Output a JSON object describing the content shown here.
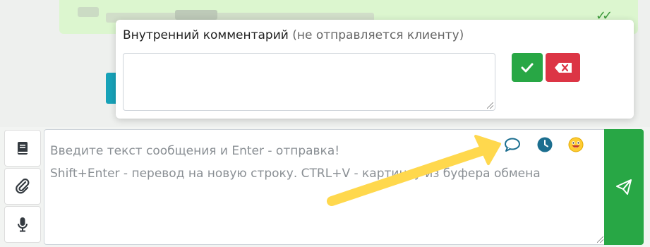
{
  "popup": {
    "title": "Внутренний комментарий",
    "subtitle": "(не отправляется клиенту)",
    "comment_value": "",
    "confirm_icon": "check-icon",
    "cancel_icon": "backspace-icon"
  },
  "composer": {
    "placeholder": "Введите текст сообщения и Enter - отправка!\nShift+Enter - перевод на новую строку. CTRL+V - картинку из буфера обмена",
    "icons": [
      "comment-icon",
      "clock-icon",
      "emoji-icon"
    ]
  },
  "sidebar": {
    "icons": [
      "book-icon",
      "paperclip-icon",
      "microphone-icon"
    ]
  },
  "send_icon": "paper-plane-icon",
  "colors": {
    "green": "#28a745",
    "red": "#dc3545",
    "teal": "#17a2b8",
    "arrow": "#ffd84d"
  }
}
